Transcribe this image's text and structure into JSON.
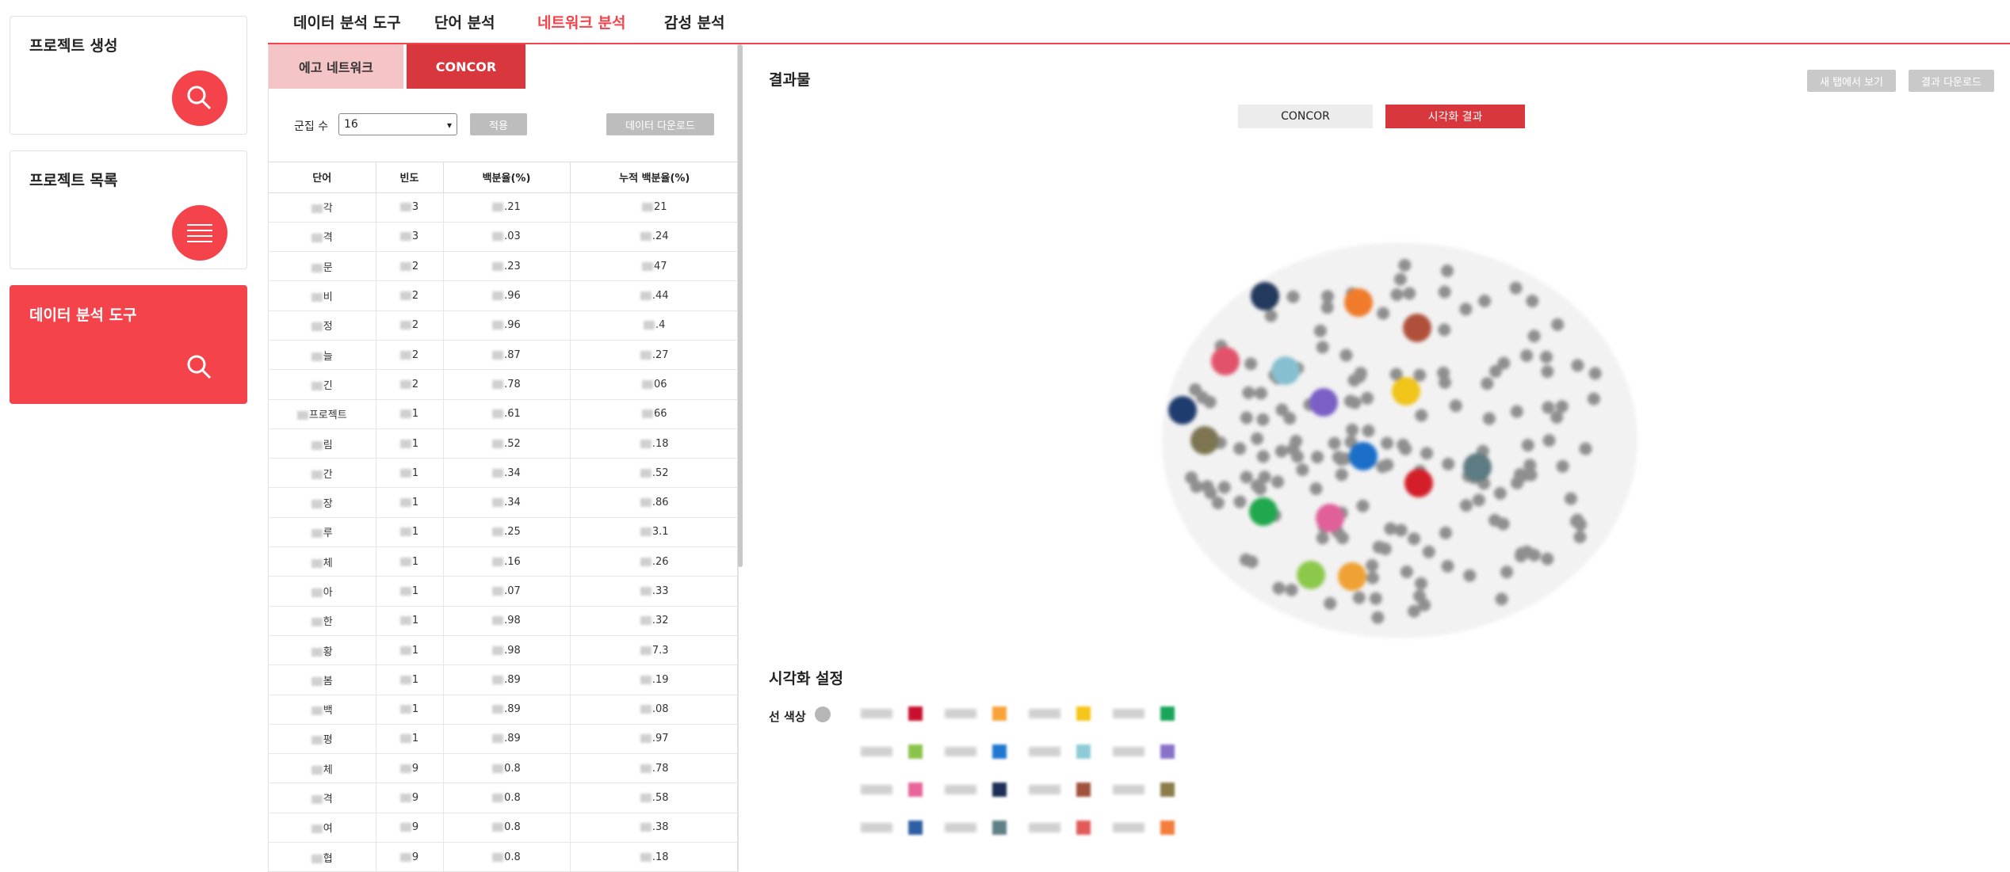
{
  "sidebar": {
    "cards": [
      {
        "title": "프로젝트 생성",
        "icon": "search-icon"
      },
      {
        "title": "프로젝트 목록",
        "icon": "list-icon"
      },
      {
        "title": "데이터 분석 도구",
        "icon": "search-icon",
        "active": true
      }
    ]
  },
  "topnav": {
    "tabs": [
      "데이터 분석 도구",
      "단어 분석",
      "네트워크 분석",
      "감성 분석"
    ],
    "active": "네트워크 분석"
  },
  "left": {
    "subtabs": [
      "에고 네트워크",
      "CONCOR"
    ],
    "cluster_label": "군집 수",
    "cluster_value": "16",
    "apply_label": "적용",
    "download_label": "데이터 다운로드",
    "table": {
      "headers": [
        "단어",
        "빈도",
        "백분율(%)",
        "누적 백분율(%)"
      ],
      "rows": [
        [
          "각",
          "3",
          ".21",
          "21"
        ],
        [
          "격",
          "3",
          ".03",
          ".24"
        ],
        [
          "문",
          "2",
          ".23",
          "47"
        ],
        [
          "비",
          "2",
          ".96",
          ".44"
        ],
        [
          "정",
          "2",
          ".96",
          ".4"
        ],
        [
          "늘",
          "2",
          ".87",
          ".27"
        ],
        [
          "긴",
          "2",
          ".78",
          "06"
        ],
        [
          "프로젝트",
          "1",
          ".61",
          "66"
        ],
        [
          "림",
          "1",
          ".52",
          ".18"
        ],
        [
          "간",
          "1",
          ".34",
          ".52"
        ],
        [
          "장",
          "1",
          ".34",
          ".86"
        ],
        [
          "루",
          "1",
          ".25",
          "3.1"
        ],
        [
          "체",
          "1",
          ".16",
          ".26"
        ],
        [
          "아",
          "1",
          ".07",
          ".33"
        ],
        [
          "한",
          "1",
          ".98",
          ".32"
        ],
        [
          "황",
          "1",
          ".98",
          "7.3"
        ],
        [
          "봄",
          "1",
          ".89",
          ".19"
        ],
        [
          "백",
          "1",
          ".89",
          ".08"
        ],
        [
          "평",
          "1",
          ".89",
          ".97"
        ],
        [
          "체",
          "9",
          "0.8",
          ".78"
        ],
        [
          "격",
          "9",
          "0.8",
          ".58"
        ],
        [
          "여",
          "9",
          "0.8",
          ".38"
        ],
        [
          "협",
          "9",
          "0.8",
          ".18"
        ]
      ]
    }
  },
  "right": {
    "title": "결과물",
    "new_tab_label": "새 탭에서 보기",
    "download_result_label": "결과 다운로드",
    "toggle": [
      "CONCOR",
      "시각화 결과"
    ],
    "settings_title": "시각화 설정",
    "line_color_label": "선 색상",
    "palette_colors": [
      "#c8102e",
      "#f7a33a",
      "#f5c518",
      "#19a55a",
      "#8bc34a",
      "#1f77d0",
      "#8ecbd6",
      "#8a72c8",
      "#e8649a",
      "#1c2e55",
      "#a0523c",
      "#8a7d4a",
      "#2e5fa3",
      "#5f7f86",
      "#e25a5a",
      "#f47c3c"
    ],
    "graph_colors": {
      "navy": "#23395d",
      "orange": "#f07b2a",
      "brown": "#b0503b",
      "pink": "#e2536b",
      "lightblue": "#86bfd0",
      "purple": "#7b5fc6",
      "yellow": "#f0c419",
      "darknavy": "#1f3c6e",
      "olive": "#7d7552",
      "blue": "#1b6fc9",
      "slate": "#5d7b82",
      "red": "#d41f2a",
      "green": "#1fa84e",
      "rose": "#e0609a",
      "lime": "#8cc94a",
      "amber": "#f0a135"
    }
  }
}
